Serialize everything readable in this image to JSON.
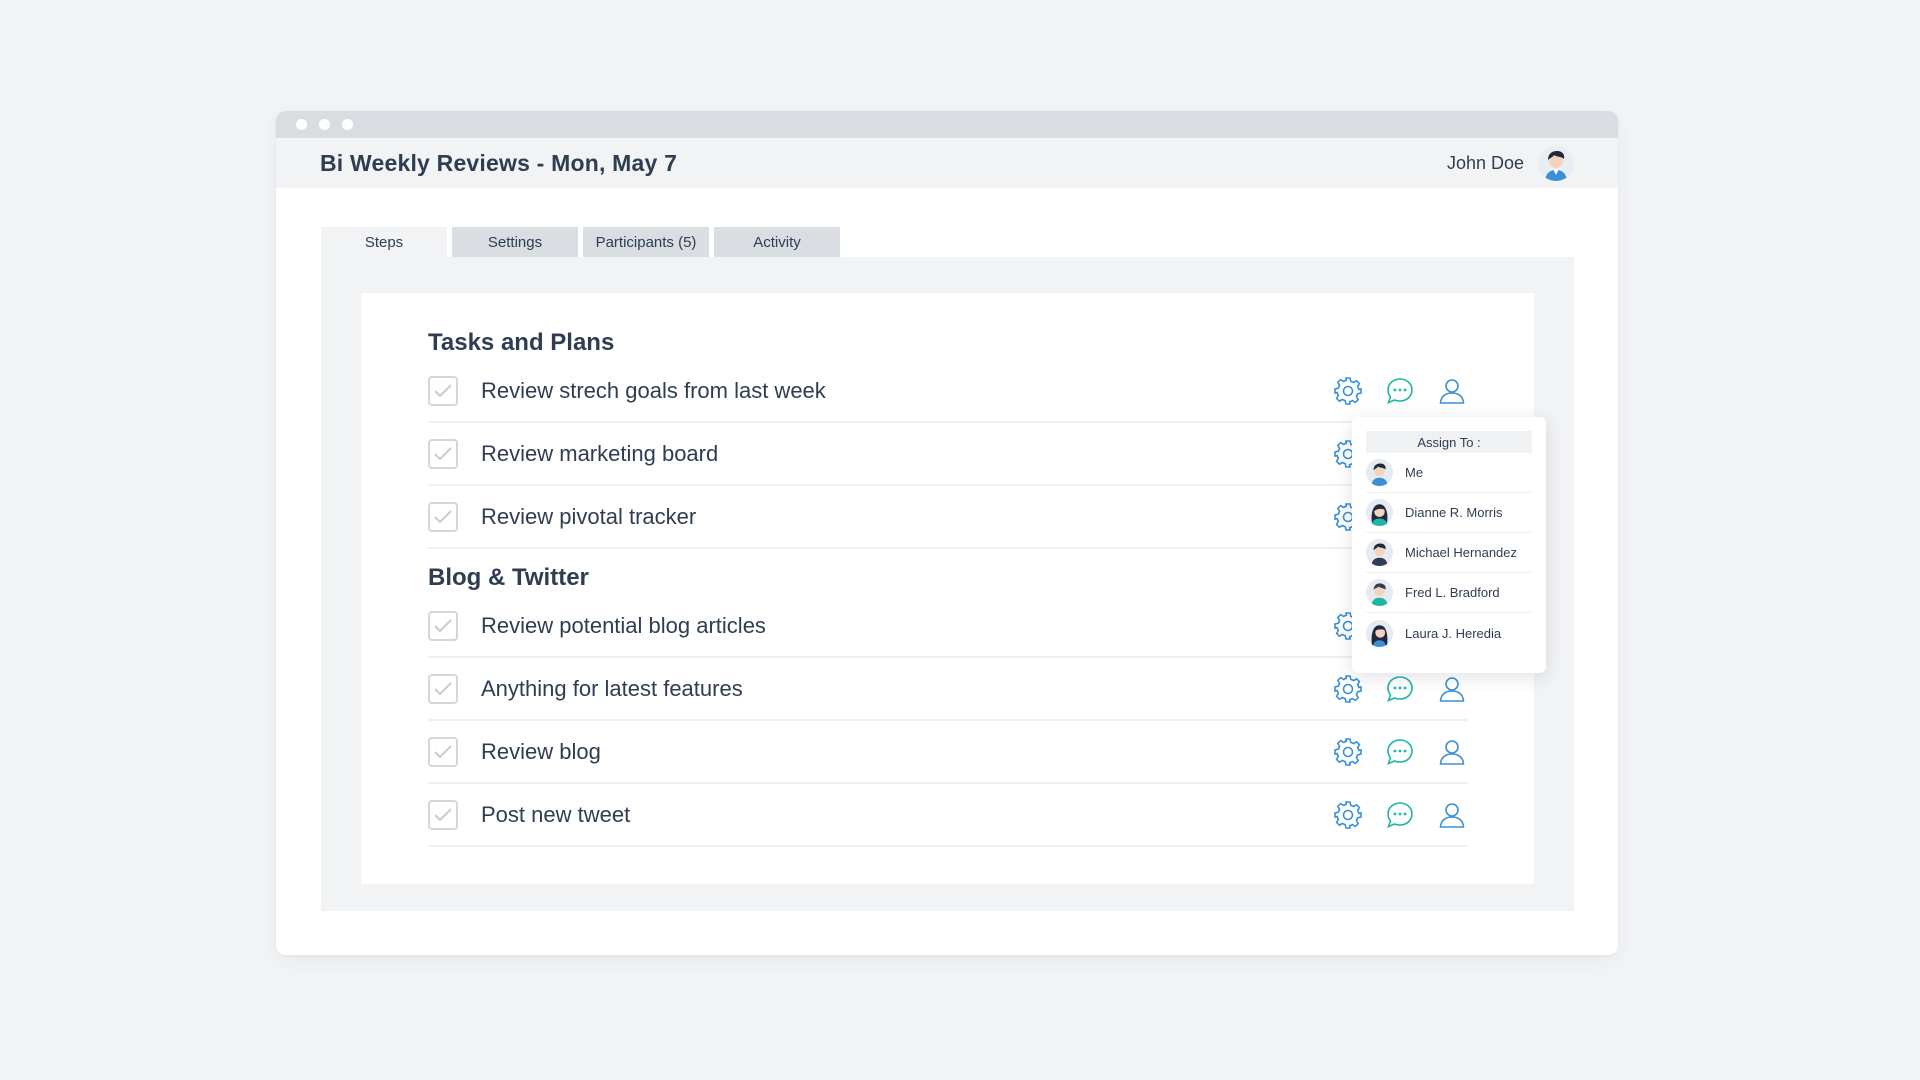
{
  "window": {
    "title": "Bi Weekly Reviews - Mon, May 7",
    "user_name": "John Doe"
  },
  "tabs": [
    {
      "label": "Steps",
      "active": true
    },
    {
      "label": "Settings",
      "active": false
    },
    {
      "label": "Participants (5)",
      "active": false
    },
    {
      "label": "Activity",
      "active": false
    }
  ],
  "sections": [
    {
      "title": "Tasks and Plans",
      "tasks": [
        {
          "label": "Review strech goals from last week"
        },
        {
          "label": "Review marketing board"
        },
        {
          "label": "Review pivotal tracker"
        }
      ]
    },
    {
      "title": "Blog & Twitter",
      "tasks": [
        {
          "label": "Review potential blog articles"
        },
        {
          "label": "Anything for latest features"
        },
        {
          "label": "Review blog"
        },
        {
          "label": "Post new tweet"
        }
      ]
    }
  ],
  "assign_dropdown": {
    "header": "Assign To :",
    "people": [
      {
        "name": "Me",
        "avatar": "male-dark-hair"
      },
      {
        "name": "Dianne R. Morris",
        "avatar": "female-dark-hair"
      },
      {
        "name": "Michael Hernandez",
        "avatar": "male-dark-hair"
      },
      {
        "name": "Fred L. Bradford",
        "avatar": "male-dark-hair"
      },
      {
        "name": "Laura J. Heredia",
        "avatar": "female-dark-hair"
      }
    ]
  },
  "icons": {
    "settings": "gear-icon",
    "comment": "comment-bubble-icon",
    "assign": "user-icon",
    "check": "check-icon"
  },
  "colors": {
    "gear": "#3a8fd6",
    "comment": "#1fb6a6",
    "user": "#3a8fd6",
    "text": "#2f3d52"
  }
}
